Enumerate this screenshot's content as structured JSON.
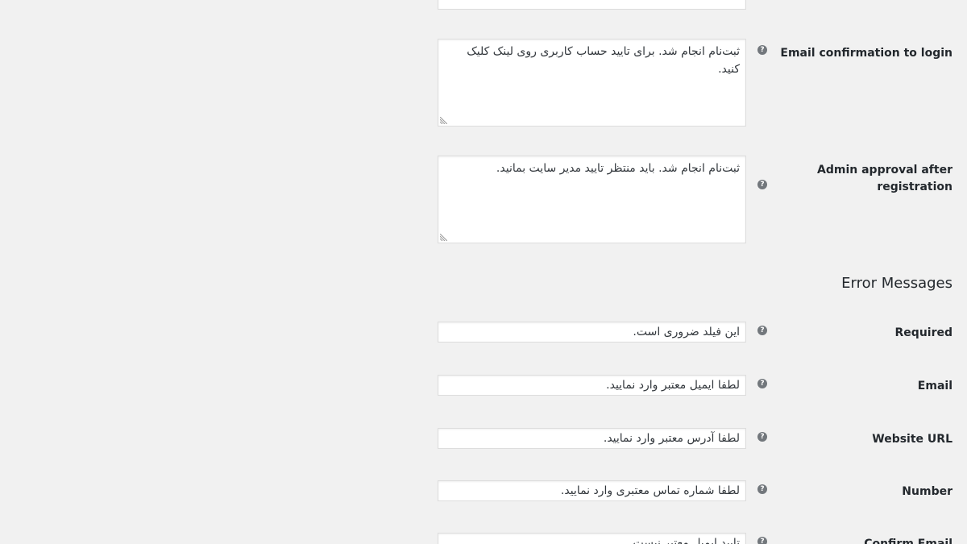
{
  "messages": {
    "top_partial": {
      "value": ""
    },
    "email_confirmation": {
      "label": "Email confirmation to login",
      "value": "ثبت‌نام انجام شد. برای تایید حساب کاربری روی لینک کلیک کنید."
    },
    "admin_approval": {
      "label": "Admin approval after registration",
      "value": "ثبت‌نام انجام شد. باید منتظر تایید مدیر سایت بمانید."
    }
  },
  "error_messages": {
    "heading": "Error Messages",
    "required": {
      "label": "Required",
      "value": "این فیلد ضروری است."
    },
    "email": {
      "label": "Email",
      "value": "لطفا ایمیل معتبر وارد نمایید."
    },
    "website_url": {
      "label": "Website URL",
      "value": "لطفا آدرس معتبر وارد نمایید."
    },
    "number": {
      "label": "Number",
      "value": "لطفا شماره تماس معتبری وارد نمایید."
    },
    "confirm_email": {
      "label": "Confirm Email",
      "value": "تایید ایمیل معتبر نیست."
    }
  },
  "help_icon": {
    "glyph": "?",
    "icon": "question-circle-icon",
    "color": "#72777c"
  }
}
